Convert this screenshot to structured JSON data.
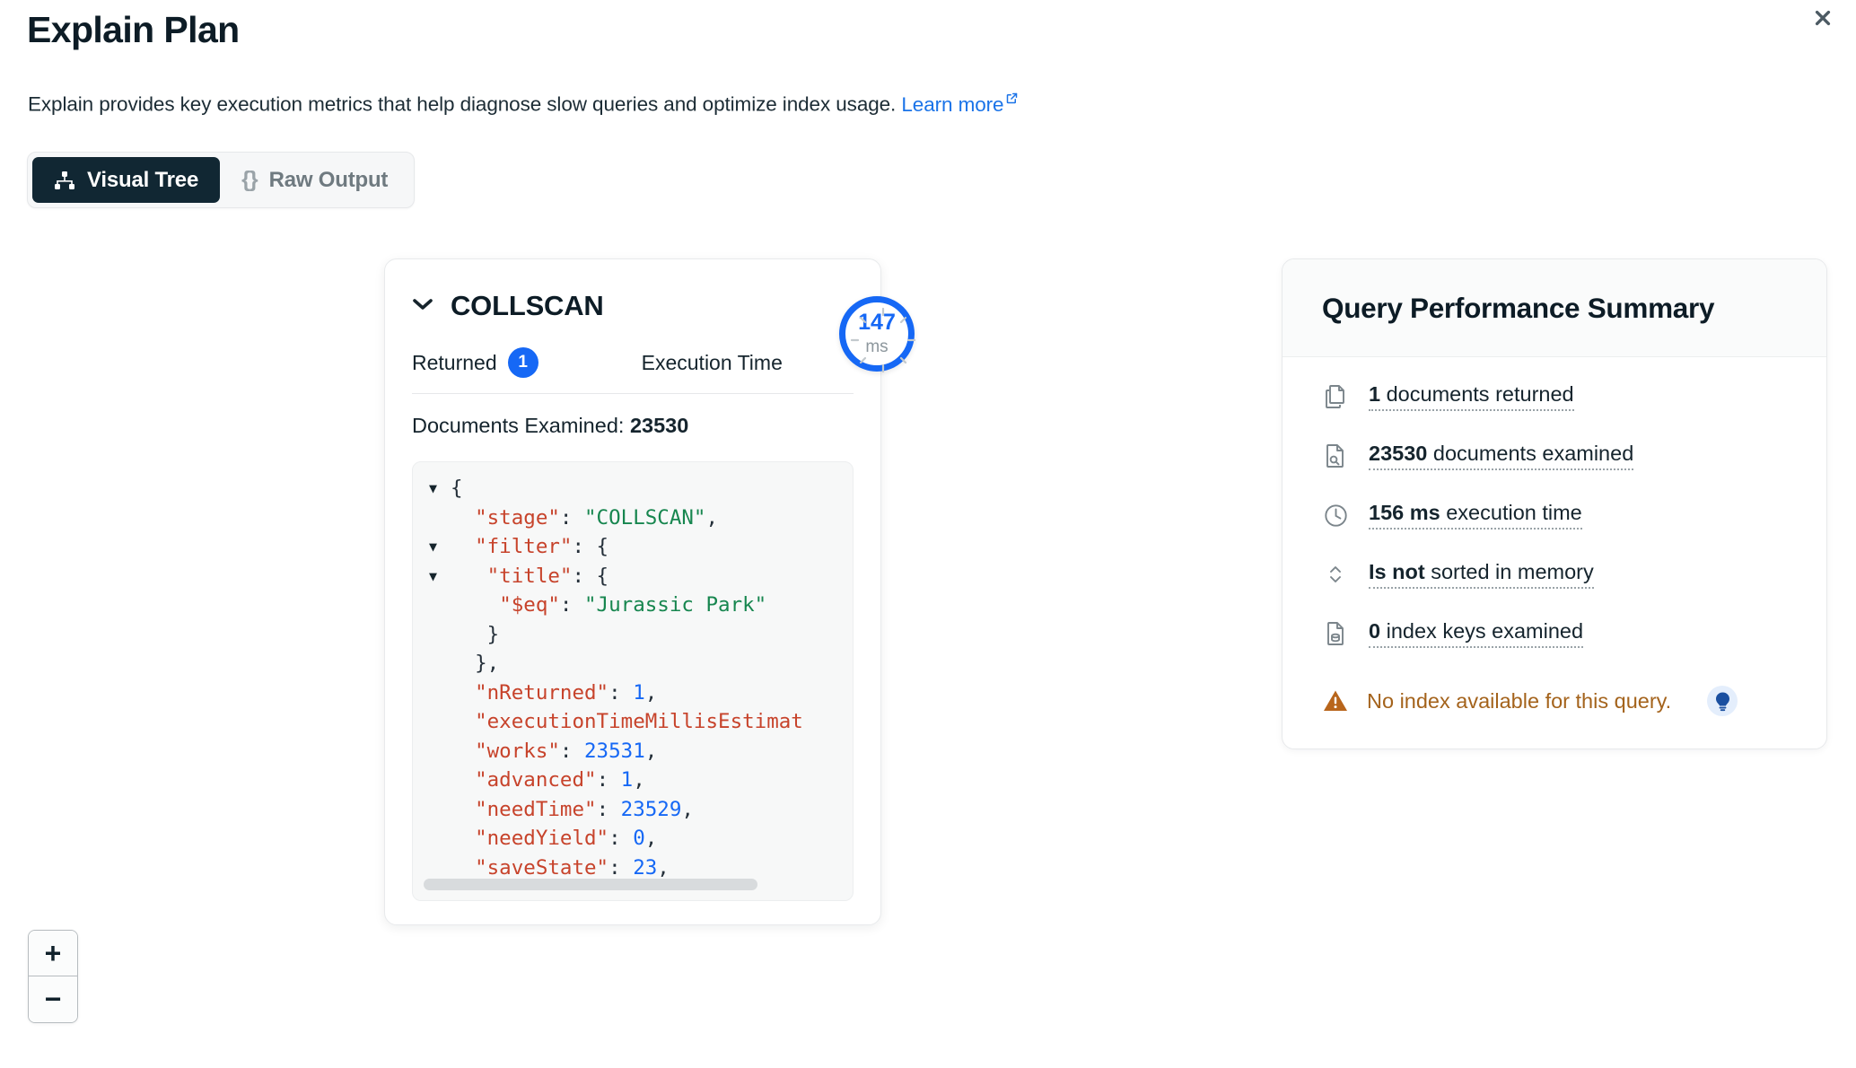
{
  "header": {
    "title": "Explain Plan",
    "subtitle": "Explain provides key execution metrics that help diagnose slow queries and optimize index usage.",
    "learn_more": "Learn more",
    "close_icon": "close-icon",
    "external-link-icon": "external-link-icon"
  },
  "tabs": [
    {
      "label": "Visual Tree",
      "icon": "tree-icon",
      "active": true
    },
    {
      "label": "Raw Output",
      "icon": "braces-icon",
      "active": false
    }
  ],
  "stage": {
    "name": "COLLSCAN",
    "chevron_icon": "chevron-down-icon",
    "returned_label": "Returned",
    "returned_count": "1",
    "execution_time_label": "Execution Time",
    "execution_time_value": "147",
    "execution_time_unit": "ms",
    "documents_examined_label": "Documents Examined:",
    "documents_examined_value": "23530",
    "json_lines": [
      {
        "caret": true,
        "text": "{"
      },
      {
        "caret": false,
        "segments": [
          {
            "t": "  ",
            "c": "p"
          },
          {
            "t": "\"stage\"",
            "c": "k"
          },
          {
            "t": ": ",
            "c": "p"
          },
          {
            "t": "\"COLLSCAN\"",
            "c": "s"
          },
          {
            "t": ",",
            "c": "p"
          }
        ]
      },
      {
        "caret": true,
        "segments": [
          {
            "t": "\"filter\"",
            "c": "k"
          },
          {
            "t": ": {",
            "c": "p"
          }
        ],
        "indent": "  "
      },
      {
        "caret": true,
        "segments": [
          {
            "t": "\"title\"",
            "c": "k"
          },
          {
            "t": ": {",
            "c": "p"
          }
        ],
        "indent": "   "
      },
      {
        "caret": false,
        "segments": [
          {
            "t": "    ",
            "c": "p"
          },
          {
            "t": "\"$eq\"",
            "c": "k"
          },
          {
            "t": ": ",
            "c": "p"
          },
          {
            "t": "\"Jurassic Park\"",
            "c": "s"
          }
        ]
      },
      {
        "caret": false,
        "segments": [
          {
            "t": "   }",
            "c": "p"
          }
        ]
      },
      {
        "caret": false,
        "segments": [
          {
            "t": "  },",
            "c": "p"
          }
        ]
      },
      {
        "caret": false,
        "segments": [
          {
            "t": "  ",
            "c": "p"
          },
          {
            "t": "\"nReturned\"",
            "c": "k"
          },
          {
            "t": ": ",
            "c": "p"
          },
          {
            "t": "1",
            "c": "n"
          },
          {
            "t": ",",
            "c": "p"
          }
        ]
      },
      {
        "caret": false,
        "segments": [
          {
            "t": "  ",
            "c": "p"
          },
          {
            "t": "\"executionTimeMillisEstimat",
            "c": "k"
          }
        ]
      },
      {
        "caret": false,
        "segments": [
          {
            "t": "  ",
            "c": "p"
          },
          {
            "t": "\"works\"",
            "c": "k"
          },
          {
            "t": ": ",
            "c": "p"
          },
          {
            "t": "23531",
            "c": "n"
          },
          {
            "t": ",",
            "c": "p"
          }
        ]
      },
      {
        "caret": false,
        "segments": [
          {
            "t": "  ",
            "c": "p"
          },
          {
            "t": "\"advanced\"",
            "c": "k"
          },
          {
            "t": ": ",
            "c": "p"
          },
          {
            "t": "1",
            "c": "n"
          },
          {
            "t": ",",
            "c": "p"
          }
        ]
      },
      {
        "caret": false,
        "segments": [
          {
            "t": "  ",
            "c": "p"
          },
          {
            "t": "\"needTime\"",
            "c": "k"
          },
          {
            "t": ": ",
            "c": "p"
          },
          {
            "t": "23529",
            "c": "n"
          },
          {
            "t": ",",
            "c": "p"
          }
        ]
      },
      {
        "caret": false,
        "segments": [
          {
            "t": "  ",
            "c": "p"
          },
          {
            "t": "\"needYield\"",
            "c": "k"
          },
          {
            "t": ": ",
            "c": "p"
          },
          {
            "t": "0",
            "c": "n"
          },
          {
            "t": ",",
            "c": "p"
          }
        ]
      },
      {
        "caret": false,
        "segments": [
          {
            "t": "  ",
            "c": "p"
          },
          {
            "t": "\"saveState\"",
            "c": "k"
          },
          {
            "t": ": ",
            "c": "p"
          },
          {
            "t": "23",
            "c": "n"
          },
          {
            "t": ",",
            "c": "p"
          }
        ]
      }
    ]
  },
  "summary": {
    "title": "Query Performance Summary",
    "rows": [
      {
        "icon": "documents-icon",
        "bold": "1",
        "rest": " documents returned"
      },
      {
        "icon": "document-search-icon",
        "bold": "23530",
        "rest": " documents examined"
      },
      {
        "icon": "clock-icon",
        "bold": "156 ms",
        "rest": " execution time"
      },
      {
        "icon": "sort-icon",
        "bold": "Is not",
        "rest": " sorted in memory"
      },
      {
        "icon": "index-keys-icon",
        "bold": "0",
        "rest": " index keys examined"
      }
    ],
    "warning": {
      "icon": "warning-triangle-icon",
      "text": "No index available for this query.",
      "hint_icon": "lightbulb-icon"
    }
  },
  "zoom_controls": {
    "zoom_in_label": "+",
    "zoom_out_label": "−"
  },
  "colors": {
    "accent_blue": "#1668f5",
    "link_blue": "#1a73e8",
    "dark": "#112733",
    "warning": "#a4631c",
    "json_key": "#c7432b",
    "json_string": "#17864f",
    "json_number": "#1668f5"
  }
}
